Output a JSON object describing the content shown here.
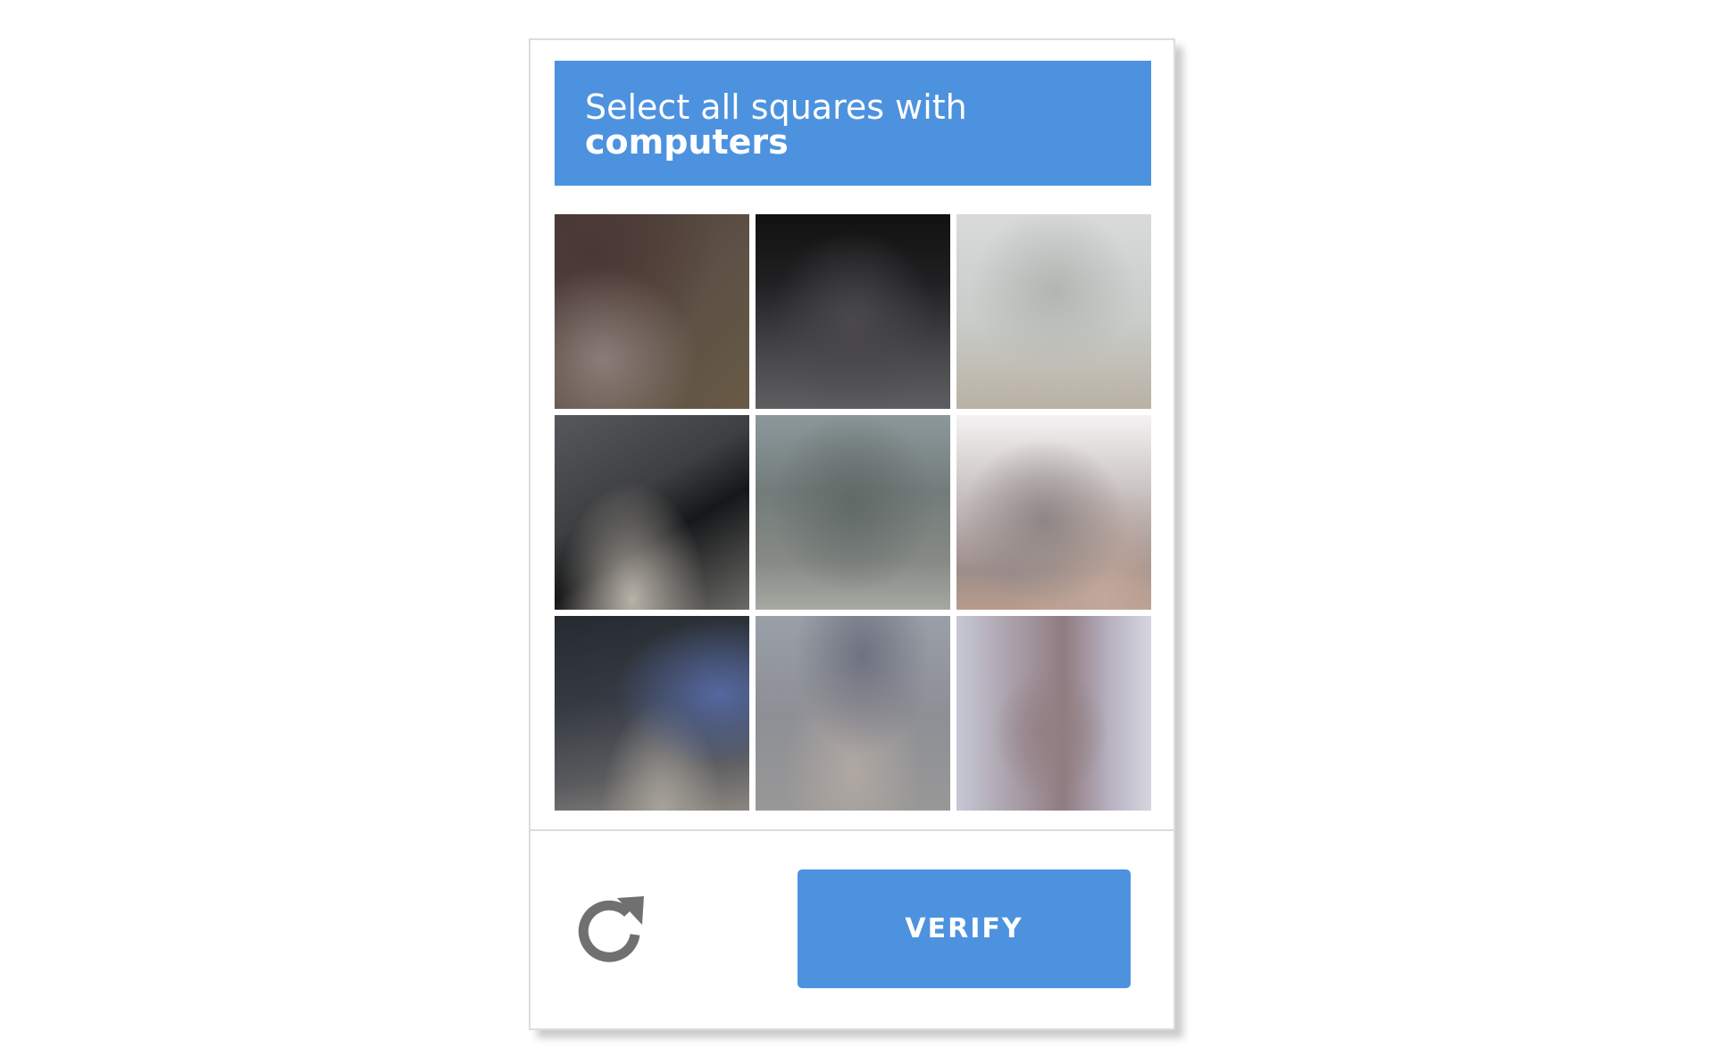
{
  "captcha": {
    "instruction": "Select all squares with",
    "target_object": "computers",
    "accent_color": "#4d92df",
    "tiles": [
      {
        "id": "tile-1"
      },
      {
        "id": "tile-2"
      },
      {
        "id": "tile-3"
      },
      {
        "id": "tile-4"
      },
      {
        "id": "tile-5"
      },
      {
        "id": "tile-6"
      },
      {
        "id": "tile-7"
      },
      {
        "id": "tile-8"
      },
      {
        "id": "tile-9"
      }
    ],
    "reload_icon": "reload-icon",
    "verify_label": "VERIFY"
  }
}
